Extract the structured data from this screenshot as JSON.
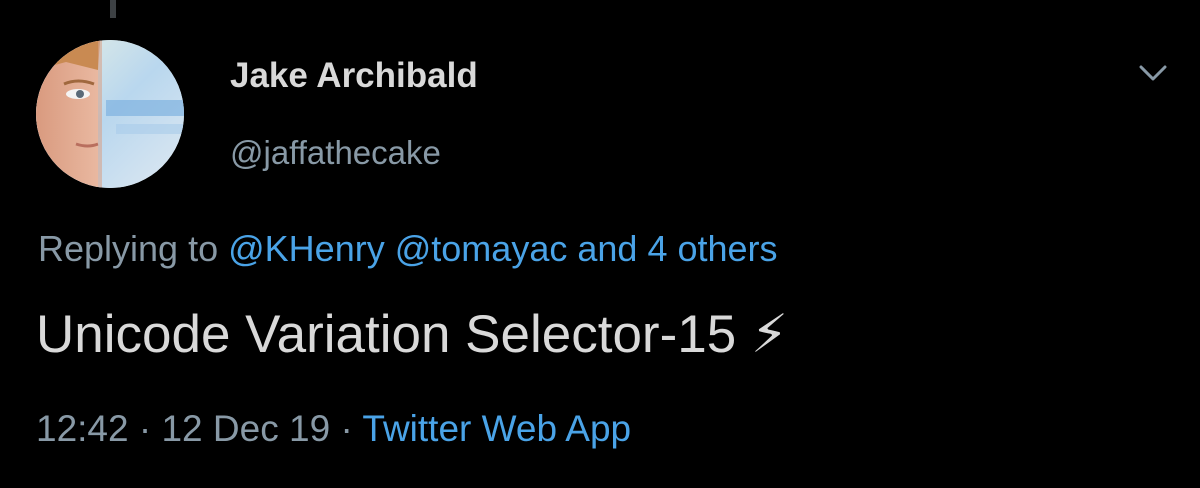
{
  "tweet": {
    "author_name": "Jake Archibald",
    "author_handle": "@jaffathecake",
    "replying_to_prefix": "Replying to",
    "reply_mentions": [
      "@KHenry",
      "@tomayac"
    ],
    "reply_and": "and",
    "reply_others": "4 others",
    "text": "Unicode Variation Selector-15 ⚡︎",
    "time": "12:42",
    "date": "12 Dec 19",
    "separator": "·",
    "source": "Twitter Web App"
  },
  "icons": {
    "menu": "chevron-down-icon",
    "avatar": "avatar-photo"
  },
  "colors": {
    "background": "#000000",
    "primary_text": "#d9d9d9",
    "secondary_text": "#8899a6",
    "link": "#4aa3e7"
  }
}
